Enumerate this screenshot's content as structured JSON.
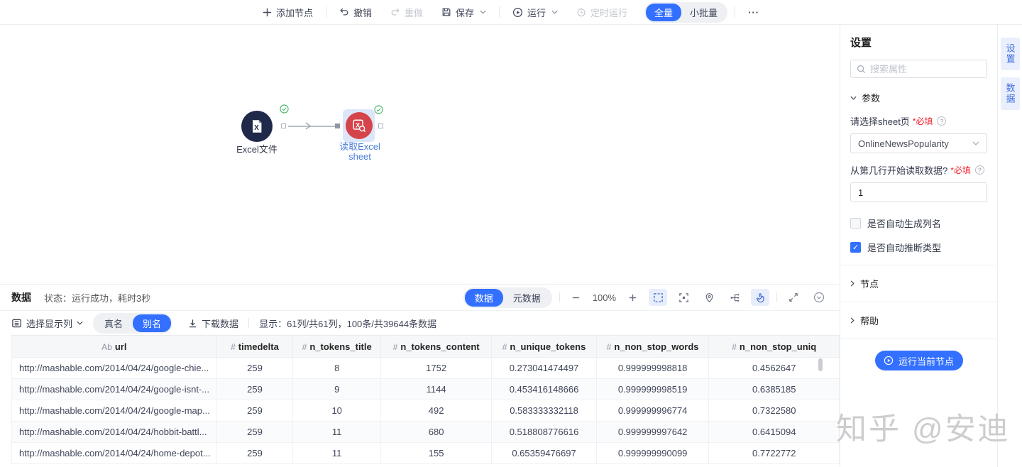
{
  "colors": {
    "accent": "#3370ff",
    "node_navy": "#20294a",
    "node_red": "#d5444b",
    "check_green": "#3ab15c",
    "required_red": "#f5222d"
  },
  "toolbar": {
    "add_node": "添加节点",
    "undo": "撤销",
    "redo": "重做",
    "save": "保存",
    "run": "运行",
    "scheduled_run": "定时运行",
    "mode_full": "全量",
    "mode_batch": "小批量",
    "more": "···"
  },
  "canvas": {
    "node_excel_label": "Excel文件",
    "node_read_label": "读取Excel sheet"
  },
  "settings": {
    "title": "设置",
    "search_placeholder": "搜索属性",
    "params_section": "参数",
    "sheet_label": "请选择sheet页",
    "required": "*必填",
    "help_mark": "?",
    "sheet_value": "OnlineNewsPopularity",
    "start_row_label": "从第几行开始读取数据?",
    "start_row_value": "1",
    "auto_colname": "是否自动生成列名",
    "auto_infer": "是否自动推断类型",
    "node_section": "节点",
    "help_section": "帮助",
    "run_button": "运行当前节点"
  },
  "side_tabs": {
    "settings": "设置",
    "data": "数据"
  },
  "data_panel": {
    "title": "数据",
    "status": "状态：运行成功，耗时3秒",
    "tab_data": "数据",
    "tab_meta": "元数据",
    "zoom": "100%",
    "select_columns": "选择显示列",
    "toggle_real": "真名",
    "toggle_alias": "别名",
    "download": "下载数据",
    "display_info": "显示：61列/共61列，100条/共39644条数据"
  },
  "table": {
    "columns": [
      {
        "type": "Ab",
        "name": "url"
      },
      {
        "type": "#",
        "name": "timedelta"
      },
      {
        "type": "#",
        "name": "n_tokens_title"
      },
      {
        "type": "#",
        "name": "n_tokens_content"
      },
      {
        "type": "#",
        "name": "n_unique_tokens"
      },
      {
        "type": "#",
        "name": "n_non_stop_words"
      },
      {
        "type": "#",
        "name": "n_non_stop_uniq"
      }
    ],
    "rows": [
      [
        "http://mashable.com/2014/04/24/google-chie...",
        "259",
        "8",
        "1752",
        "0.273041474497",
        "0.999999998818",
        "0.4562647"
      ],
      [
        "http://mashable.com/2014/04/24/google-isnt-...",
        "259",
        "9",
        "1144",
        "0.453416148666",
        "0.999999998519",
        "0.6385185"
      ],
      [
        "http://mashable.com/2014/04/24/google-map...",
        "259",
        "10",
        "492",
        "0.583333332118",
        "0.999999996774",
        "0.7322580"
      ],
      [
        "http://mashable.com/2014/04/24/hobbit-battl...",
        "259",
        "11",
        "680",
        "0.518808776616",
        "0.999999997642",
        "0.6415094"
      ],
      [
        "http://mashable.com/2014/04/24/home-depot...",
        "259",
        "11",
        "155",
        "0.65359476697",
        "0.999999990099",
        "0.7722772"
      ]
    ]
  },
  "watermark": "知乎 @安迪"
}
